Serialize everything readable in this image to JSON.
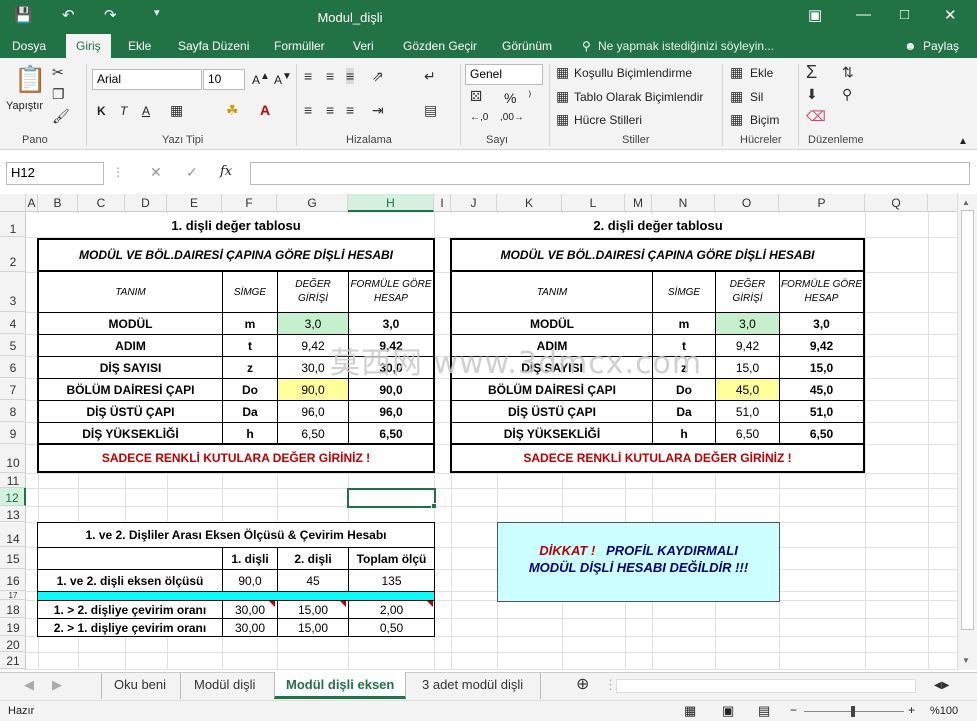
{
  "window": {
    "title": "Modul_dişli"
  },
  "tabs": [
    "Dosya",
    "Giriş",
    "Ekle",
    "Sayfa Düzeni",
    "Formüller",
    "Veri",
    "Gözden Geçir",
    "Görünüm"
  ],
  "tell_me": "Ne yapmak istediğinizi söyleyin...",
  "share": "Paylaş",
  "ribbon": {
    "paste": "Yapıştır",
    "font_name": "Arial",
    "font_size": "10",
    "number_format": "Genel",
    "cond_format": "Koşullu Biçimlendirme",
    "table_format": "Tablo Olarak Biçimlendir",
    "cell_styles": "Hücre Stilleri",
    "insert": "Ekle",
    "delete": "Sil",
    "format": "Biçim",
    "groups": {
      "clipboard": "Pano",
      "font": "Yazı Tipi",
      "alignment": "Hizalama",
      "number": "Sayı",
      "styles": "Stiller",
      "cells": "Hücreler",
      "editing": "Düzenleme"
    }
  },
  "formula_bar": {
    "name_box": "H12",
    "fx": "fx",
    "value": ""
  },
  "columns": [
    "A",
    "B",
    "C",
    "D",
    "E",
    "F",
    "G",
    "H",
    "I",
    "J",
    "K",
    "L",
    "M",
    "N",
    "O",
    "P",
    "Q"
  ],
  "rows": [
    "1",
    "2",
    "3",
    "4",
    "5",
    "6",
    "7",
    "8",
    "9",
    "10",
    "11",
    "12",
    "13",
    "14",
    "15",
    "16",
    "17",
    "18",
    "19",
    "20",
    "21"
  ],
  "table1": {
    "title": "1. dişli değer tablosu",
    "header": "MODÜL VE BÖL.DAIRESİ ÇAPINA GÖRE DİŞLİ HESABI",
    "col_tanim": "TANIM",
    "col_simge": "SİMGE",
    "col_deger": "DEĞER GİRİŞİ",
    "col_formul": "FORMÜLE GÖRE HESAP",
    "rows": [
      {
        "tanim": "MODÜL",
        "simge": "m",
        "deger": "3,0",
        "hesap": "3,0"
      },
      {
        "tanim": "ADIM",
        "simge": "t",
        "deger": "9,42",
        "hesap": "9,42"
      },
      {
        "tanim": "DİŞ SAYISI",
        "simge": "z",
        "deger": "30,0",
        "hesap": "30,0"
      },
      {
        "tanim": "BÖLÜM DAİRESİ ÇAPI",
        "simge": "Do",
        "deger": "90,0",
        "hesap": "90,0"
      },
      {
        "tanim": "DİŞ ÜSTÜ ÇAPI",
        "simge": "Da",
        "deger": "96,0",
        "hesap": "96,0"
      },
      {
        "tanim": "DİŞ YÜKSEKLİĞİ",
        "simge": "h",
        "deger": "6,50",
        "hesap": "6,50"
      }
    ],
    "note": "SADECE RENKLİ KUTULARA DEĞER GİRİNİZ !"
  },
  "table2": {
    "title": "2. dişli değer tablosu",
    "header": "MODÜL VE BÖL.DAIRESİ ÇAPINA GÖRE DİŞLİ HESABI",
    "col_tanim": "TANIM",
    "col_simge": "SİMGE",
    "col_deger": "DEĞER GİRİŞİ",
    "col_formul": "FORMÜLE GÖRE HESAP",
    "rows": [
      {
        "tanim": "MODÜL",
        "simge": "m",
        "deger": "3,0",
        "hesap": "3,0"
      },
      {
        "tanim": "ADIM",
        "simge": "t",
        "deger": "9,42",
        "hesap": "9,42"
      },
      {
        "tanim": "DİŞ SAYISI",
        "simge": "z",
        "deger": "15,0",
        "hesap": "15,0"
      },
      {
        "tanim": "BÖLÜM DAİRESİ ÇAPI",
        "simge": "Do",
        "deger": "45,0",
        "hesap": "45,0"
      },
      {
        "tanim": "DİŞ ÜSTÜ ÇAPI",
        "simge": "Da",
        "deger": "51,0",
        "hesap": "51,0"
      },
      {
        "tanim": "DİŞ YÜKSEKLİĞİ",
        "simge": "h",
        "deger": "6,50",
        "hesap": "6,50"
      }
    ],
    "note": "SADECE RENKLİ KUTULARA DEĞER GİRİNİZ !"
  },
  "table3": {
    "title": "1. ve 2. Dişliler Arası Eksen Ölçüsü & Çevirim Hesabı",
    "h1": "1. dişli",
    "h2": "2. dişli",
    "h3": "Toplam ölçü",
    "r16": {
      "label": "1. ve 2. dişli eksen ölçüsü",
      "v1": "90,0",
      "v2": "45",
      "v3": "135"
    },
    "r18": {
      "label": "1. > 2. dişliye çevirim oranı",
      "v1": "30,00",
      "v2": "15,00",
      "v3": "2,00"
    },
    "r19": {
      "label": "2. > 1. dişliye çevirim oranı",
      "v1": "30,00",
      "v2": "15,00",
      "v3": "0,50"
    }
  },
  "warning": {
    "line1a": "DİKKAT !",
    "line1b": "PROFİL KAYDIRMALI",
    "line2": "MODÜL DİŞLİ HESABI DEĞİLDİR !!!"
  },
  "watermark": "莫西网 www.3dmcx.com",
  "sheets": [
    "Oku beni",
    "Modül dişli",
    "Modül dişli eksen",
    "3 adet modül dişli"
  ],
  "status": {
    "ready": "Hazır",
    "zoom": "%100"
  },
  "colors": {
    "excel_green": "#217346",
    "input_green": "#c6efce",
    "input_yellow": "#ffff99",
    "note_red": "#c00000",
    "cyan": "#00ffff",
    "warn_bg": "#ccffff"
  }
}
